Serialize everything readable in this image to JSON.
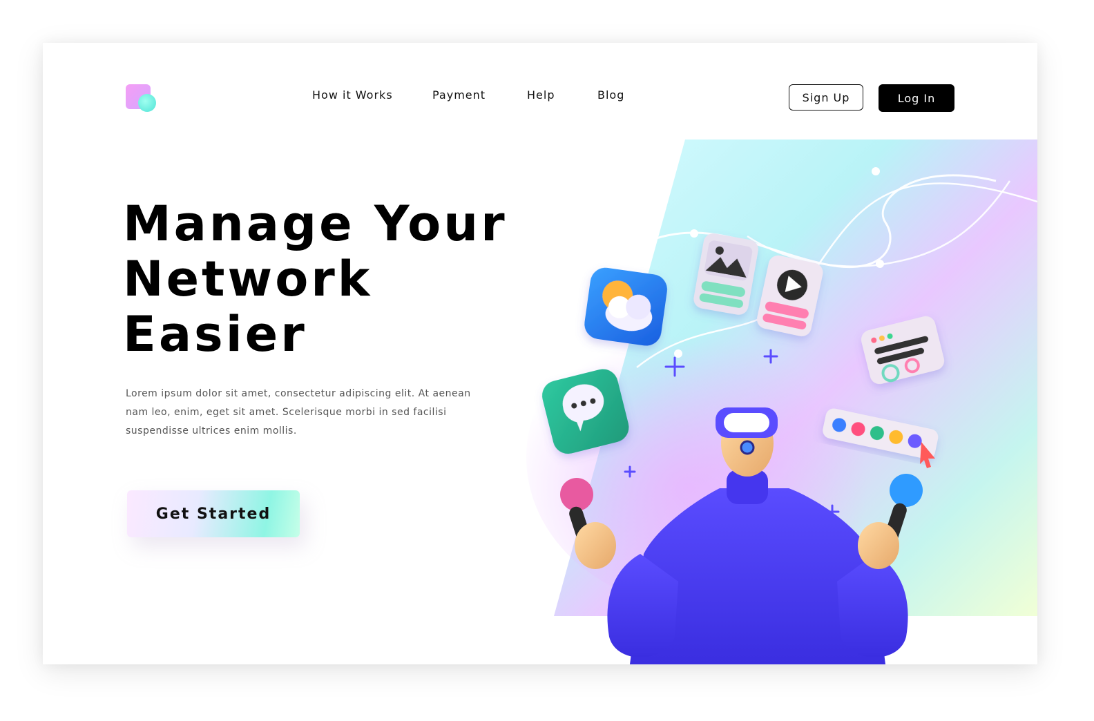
{
  "nav": {
    "items": [
      "How it Works",
      "Payment",
      "Help",
      "Blog"
    ]
  },
  "auth": {
    "signup_label": "Sign Up",
    "login_label": "Log In"
  },
  "hero": {
    "headline_lines": [
      "Manage Your",
      "Network",
      "Easier"
    ],
    "description": "Lorem ipsum dolor sit amet, consectetur adipiscing elit. At aenean nam leo, enim, eget sit amet. Scelerisque morbi in sed facilisi suspendisse ultrices enim mollis.",
    "cta_label": "Get Started"
  },
  "colors": {
    "accent": "#000000",
    "figure_shirt": "#4b3ff0",
    "gradient_mint": "#8ff5e4",
    "gradient_pink": "#e9c6ff"
  },
  "icons": [
    "logo-icon",
    "weather-app-icon",
    "gallery-card-icon",
    "video-card-icon",
    "chat-bubble-icon",
    "window-card-icon",
    "color-palette-icon",
    "cursor-icon",
    "vr-headset-icon",
    "plus-icon"
  ]
}
